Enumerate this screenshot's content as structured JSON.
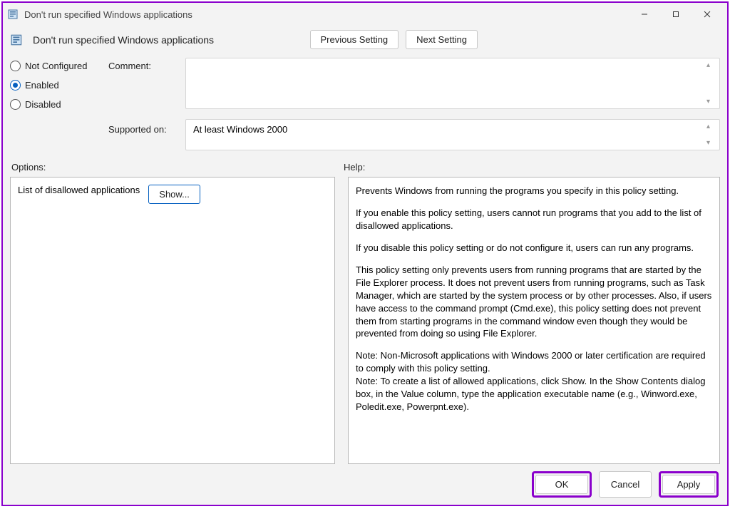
{
  "window": {
    "title": "Don't run specified Windows applications"
  },
  "header": {
    "policy_title": "Don't run specified Windows applications",
    "previous_btn": "Previous Setting",
    "next_btn": "Next Setting"
  },
  "state": {
    "not_configured": "Not Configured",
    "enabled": "Enabled",
    "disabled": "Disabled",
    "selected": "enabled"
  },
  "labels": {
    "comment": "Comment:",
    "supported_on": "Supported on:",
    "options": "Options:",
    "help": "Help:"
  },
  "supported_text": "At least Windows 2000",
  "options_panel": {
    "list_label": "List of disallowed applications",
    "show_btn": "Show..."
  },
  "help_text": {
    "p1": "Prevents Windows from running the programs you specify in this policy setting.",
    "p2": "If you enable this policy setting, users cannot run programs that you add to the list of disallowed applications.",
    "p3": "If you disable this policy setting or do not configure it, users can run any programs.",
    "p4": "This policy setting only prevents users from running programs that are started by the File Explorer process. It does not prevent users from running programs, such as Task Manager, which are started by the system process or by other processes.  Also, if users have access to the command prompt (Cmd.exe), this policy setting does not prevent them from starting programs in the command window even though they would be prevented from doing so using File Explorer.",
    "p5": "Note: Non-Microsoft applications with Windows 2000 or later certification are required to comply with this policy setting.",
    "p6": "Note: To create a list of allowed applications, click Show.  In the Show Contents dialog box, in the Value column, type the application executable name (e.g., Winword.exe, Poledit.exe, Powerpnt.exe)."
  },
  "footer": {
    "ok": "OK",
    "cancel": "Cancel",
    "apply": "Apply"
  }
}
